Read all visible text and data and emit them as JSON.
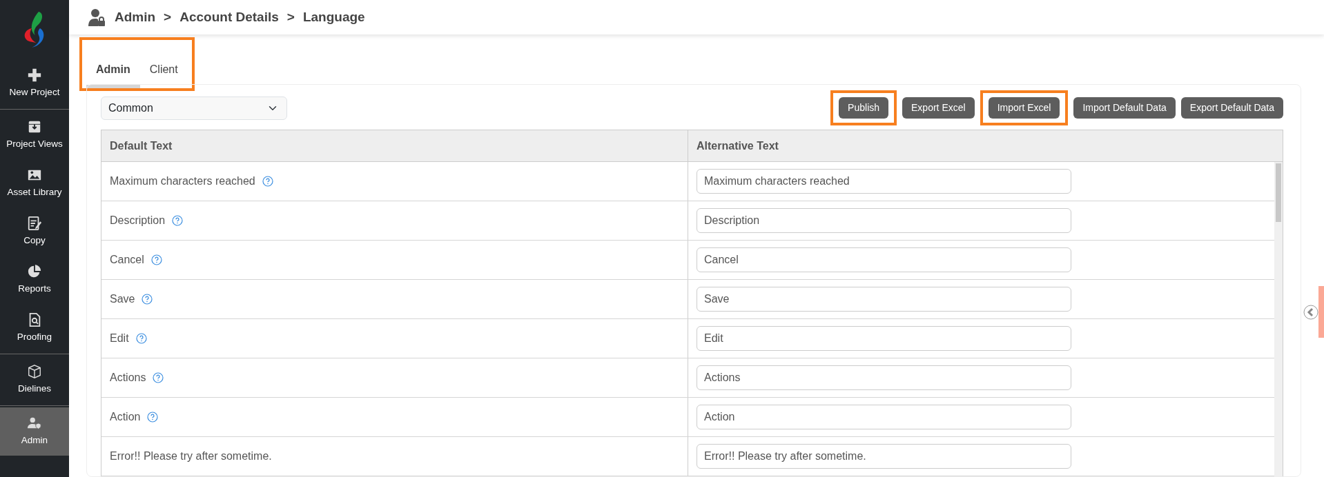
{
  "sidebar": {
    "items": [
      {
        "label": "New Project",
        "selected": false,
        "divider_after": true
      },
      {
        "label": "Project Views",
        "selected": false,
        "divider_after": false
      },
      {
        "label": "Asset Library",
        "selected": false,
        "divider_after": false
      },
      {
        "label": "Copy",
        "selected": false,
        "divider_after": false
      },
      {
        "label": "Reports",
        "selected": false,
        "divider_after": false
      },
      {
        "label": "Proofing",
        "selected": false,
        "divider_after": true
      },
      {
        "label": "Dielines",
        "selected": false,
        "divider_after": true
      },
      {
        "label": "Admin",
        "selected": true,
        "divider_after": false
      }
    ]
  },
  "breadcrumb": [
    {
      "label": "Admin"
    },
    {
      "label": ">"
    },
    {
      "label": "Account Details"
    },
    {
      "label": ">"
    },
    {
      "label": "Language"
    }
  ],
  "tabs": [
    {
      "label": "Admin",
      "selected": true
    },
    {
      "label": "Client",
      "selected": false
    }
  ],
  "section_select": {
    "value": "Common"
  },
  "buttons": [
    {
      "label": "Publish",
      "highlighted": true
    },
    {
      "label": "Export Excel",
      "highlighted": false
    },
    {
      "label": "Import Excel",
      "highlighted": true
    },
    {
      "label": "Import Default Data",
      "highlighted": false
    },
    {
      "label": "Export Default Data",
      "highlighted": false
    }
  ],
  "table": {
    "columns": [
      "Default Text",
      "Alternative Text"
    ],
    "rows": [
      {
        "default_text": "Maximum characters reached",
        "help": true,
        "alternative_text": "Maximum characters reached"
      },
      {
        "default_text": "Description",
        "help": true,
        "alternative_text": "Description"
      },
      {
        "default_text": "Cancel",
        "help": true,
        "alternative_text": "Cancel"
      },
      {
        "default_text": "Save",
        "help": true,
        "alternative_text": "Save"
      },
      {
        "default_text": "Edit",
        "help": true,
        "alternative_text": "Edit"
      },
      {
        "default_text": "Actions",
        "help": true,
        "alternative_text": "Actions"
      },
      {
        "default_text": "Action",
        "help": true,
        "alternative_text": "Action"
      },
      {
        "default_text": "Error!! Please try after sometime.",
        "help": false,
        "alternative_text": "Error!! Please try after sometime."
      }
    ]
  }
}
